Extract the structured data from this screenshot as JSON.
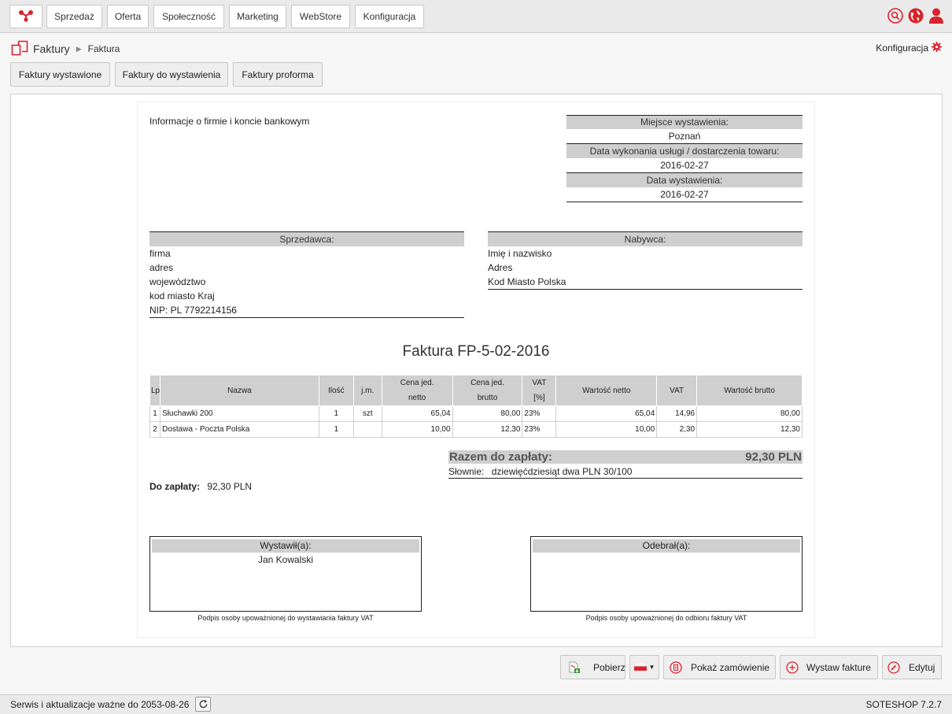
{
  "topnav": {
    "items": [
      {
        "label": "Sprzedaż"
      },
      {
        "label": "Oferta"
      },
      {
        "label": "Społeczność"
      },
      {
        "label": "Marketing"
      },
      {
        "label": "WebStore"
      },
      {
        "label": "Konfiguracja"
      }
    ],
    "icons": [
      "app-logo-icon",
      "search-icon",
      "globe-icon",
      "user-icon"
    ],
    "accent_color": "#d9232d"
  },
  "breadcrumb": {
    "section": "Faktury",
    "current": "Faktura"
  },
  "config_link": "Konfiguracja",
  "tabs": [
    {
      "label": "Faktury wystawione"
    },
    {
      "label": "Faktury do wystawienia"
    },
    {
      "label": "Faktury proforma"
    }
  ],
  "invoice": {
    "company_info": "Informacje o firmie i koncie bankowym",
    "place_label": "Miejsce wystawienia:",
    "place_value": "Poznań",
    "service_date_label": "Data wykonania usługi / dostarczenia towaru:",
    "service_date_value": "2016-02-27",
    "issue_date_label": "Data wystawienia:",
    "issue_date_value": "2016-02-27",
    "seller": {
      "label": "Sprzedawca:",
      "lines": [
        "firma",
        "adres",
        "województwo",
        "kod miasto Kraj",
        "NIP: PL 7792214156"
      ]
    },
    "buyer": {
      "label": "Nabywca:",
      "lines": [
        "Imię i nazwisko",
        "Adres",
        "Kod Miasto Polska"
      ]
    },
    "title": "Faktura FP-5-02-2016",
    "table": {
      "headers": {
        "lp": "Lp",
        "name": "Nazwa",
        "qty": "Ilość",
        "unit": "j.m.",
        "net_price_1": "Cena jed.",
        "net_price_2": "netto",
        "gross_price_1": "Cena jed.",
        "gross_price_2": "brutto",
        "vat_1": "VAT",
        "vat_2": "[%]",
        "net_value": "Wartość netto",
        "vat_amount": "VAT",
        "gross_value": "Wartość brutto"
      },
      "rows": [
        {
          "lp": "1",
          "name": "Słuchawki 200",
          "qty": "1",
          "unit": "szt",
          "net_price": "65,04",
          "gross_price": "80,00",
          "vat_rate": "23%",
          "net_value": "65,04",
          "vat_amount": "14,96",
          "gross_value": "80,00"
        },
        {
          "lp": "2",
          "name": "Dostawa - Poczta Polska",
          "qty": "1",
          "unit": "",
          "net_price": "10,00",
          "gross_price": "12,30",
          "vat_rate": "23%",
          "net_value": "10,00",
          "vat_amount": "2,30",
          "gross_value": "12,30"
        }
      ]
    },
    "total_label": "Razem do zapłaty:",
    "total_value": "92,30 PLN",
    "in_words_label": "Słownie:",
    "in_words_value": "dziewięćdziesiąt dwa PLN 30/100",
    "to_pay_label": "Do zapłaty:",
    "to_pay_value": "92,30 PLN",
    "issued_by_label": "Wystawił(a):",
    "issued_by_value": "Jan Kowalski",
    "received_by_label": "Odebrał(a):",
    "issued_caption": "Podpis osoby upoważnionej do wystawiania faktury VAT",
    "received_caption": "Podpis osoby upoważnionej do odbioru faktury VAT"
  },
  "actions": {
    "download": "Pobierz",
    "language_flag": "pl-flag-icon",
    "show_order": "Pokaż zamówienie",
    "issue_invoice": "Wystaw fakture",
    "edit": "Edytuj"
  },
  "footer": {
    "service_text": "Serwis i aktualizacje ważne do 2053-08-26",
    "version": "SOTESHOP 7.2.7"
  }
}
